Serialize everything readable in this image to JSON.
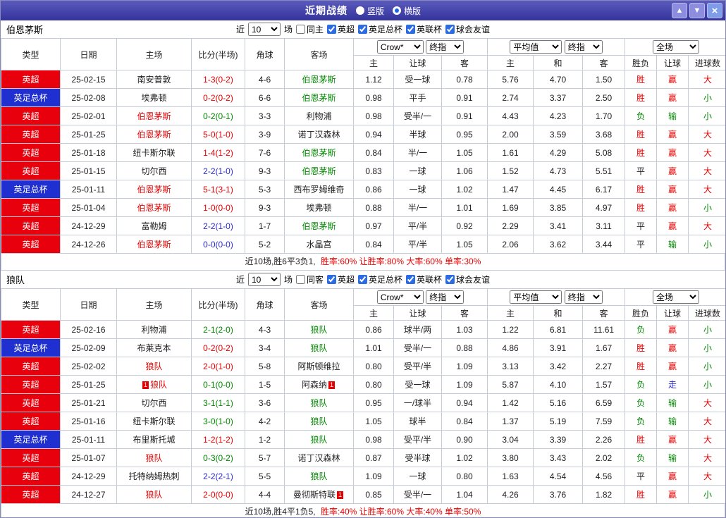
{
  "topbar": {
    "title": "近期战绩",
    "layout_options": [
      {
        "label": "竖版",
        "selected": false
      },
      {
        "label": "横版",
        "selected": true
      }
    ],
    "icons": {
      "up": "▲",
      "down": "▼",
      "close": "×"
    }
  },
  "colors": {
    "titlebar_bg": "#33339b",
    "win_red": "#e60000",
    "loss_green": "#008800",
    "draw_blue": "#2b2bd0",
    "epl_bg": "#e8000d",
    "facup_bg": "#1f2fd0"
  },
  "filters": {
    "near_label": "近",
    "count_value": "10",
    "games_label": "场",
    "leagues": [
      {
        "label": "英超",
        "checked": true
      },
      {
        "label": "英足总杯",
        "checked": true
      },
      {
        "label": "英联杯",
        "checked": true
      },
      {
        "label": "球会友谊",
        "checked": true
      }
    ]
  },
  "table_header": {
    "static_cols": [
      "类型",
      "日期",
      "主场",
      "比分(半场)",
      "角球",
      "客场"
    ],
    "group1": {
      "select_bookmaker": "Crow*",
      "select_stage": "终指"
    },
    "group2": {
      "select_avg": "平均值",
      "select_stage": "终指"
    },
    "group3": {
      "select_scope": "全场"
    },
    "sub_cols": [
      "主",
      "让球",
      "客",
      "主",
      "和",
      "客",
      "胜负",
      "让球",
      "进球数"
    ]
  },
  "sections": [
    {
      "team": "伯恩茅斯",
      "same_filter_label": "同主",
      "same_filter_checked": false,
      "summary_prefix": "近10场,胜6平3负1,",
      "summary_stats": "胜率:60% 让胜率:80% 大率:60% 单率:30%",
      "rows": [
        {
          "league": "英超",
          "league_type": "epl",
          "date": "25-02-15",
          "home": "南安普敦",
          "home_hl": false,
          "home_badge": "",
          "score": "1-3(0-2)",
          "result_type": "win",
          "corner": "4-6",
          "away": "伯恩茅斯",
          "away_hl": true,
          "away_badge": "",
          "odds": [
            "1.12",
            "受一球",
            "0.78",
            "5.76",
            "4.70",
            "1.50"
          ],
          "result": "胜",
          "result_c": "r",
          "handicap": "赢",
          "handicap_c": "r",
          "goals": "大",
          "goals_c": "r"
        },
        {
          "league": "英足总杯",
          "league_type": "facup",
          "date": "25-02-08",
          "home": "埃弗顿",
          "home_hl": false,
          "home_badge": "",
          "score": "0-2(0-2)",
          "result_type": "win",
          "corner": "6-6",
          "away": "伯恩茅斯",
          "away_hl": true,
          "away_badge": "",
          "odds": [
            "0.98",
            "平手",
            "0.91",
            "2.74",
            "3.37",
            "2.50"
          ],
          "result": "胜",
          "result_c": "r",
          "handicap": "赢",
          "handicap_c": "r",
          "goals": "小",
          "goals_c": "g"
        },
        {
          "league": "英超",
          "league_type": "epl",
          "date": "25-02-01",
          "home": "伯恩茅斯",
          "home_hl": true,
          "home_badge": "",
          "score": "0-2(0-1)",
          "result_type": "loss",
          "corner": "3-3",
          "away": "利物浦",
          "away_hl": false,
          "away_badge": "",
          "odds": [
            "0.98",
            "受半/一",
            "0.91",
            "4.43",
            "4.23",
            "1.70"
          ],
          "result": "负",
          "result_c": "g",
          "handicap": "输",
          "handicap_c": "g",
          "goals": "小",
          "goals_c": "g"
        },
        {
          "league": "英超",
          "league_type": "epl",
          "date": "25-01-25",
          "home": "伯恩茅斯",
          "home_hl": true,
          "home_badge": "",
          "score": "5-0(1-0)",
          "result_type": "win",
          "corner": "3-9",
          "away": "诺丁汉森林",
          "away_hl": false,
          "away_badge": "",
          "odds": [
            "0.94",
            "半球",
            "0.95",
            "2.00",
            "3.59",
            "3.68"
          ],
          "result": "胜",
          "result_c": "r",
          "handicap": "赢",
          "handicap_c": "r",
          "goals": "大",
          "goals_c": "r"
        },
        {
          "league": "英超",
          "league_type": "epl",
          "date": "25-01-18",
          "home": "纽卡斯尔联",
          "home_hl": false,
          "home_badge": "",
          "score": "1-4(1-2)",
          "result_type": "win",
          "corner": "7-6",
          "away": "伯恩茅斯",
          "away_hl": true,
          "away_badge": "",
          "odds": [
            "0.84",
            "半/一",
            "1.05",
            "1.61",
            "4.29",
            "5.08"
          ],
          "result": "胜",
          "result_c": "r",
          "handicap": "赢",
          "handicap_c": "r",
          "goals": "大",
          "goals_c": "r"
        },
        {
          "league": "英超",
          "league_type": "epl",
          "date": "25-01-15",
          "home": "切尔西",
          "home_hl": false,
          "home_badge": "",
          "score": "2-2(1-0)",
          "result_type": "draw",
          "corner": "9-3",
          "away": "伯恩茅斯",
          "away_hl": true,
          "away_badge": "",
          "odds": [
            "0.83",
            "一球",
            "1.06",
            "1.52",
            "4.73",
            "5.51"
          ],
          "result": "平",
          "result_c": "k",
          "handicap": "赢",
          "handicap_c": "r",
          "goals": "大",
          "goals_c": "r"
        },
        {
          "league": "英足总杯",
          "league_type": "facup",
          "date": "25-01-11",
          "home": "伯恩茅斯",
          "home_hl": true,
          "home_badge": "",
          "score": "5-1(3-1)",
          "result_type": "win",
          "corner": "5-3",
          "away": "西布罗姆维奇",
          "away_hl": false,
          "away_badge": "",
          "odds": [
            "0.86",
            "一球",
            "1.02",
            "1.47",
            "4.45",
            "6.17"
          ],
          "result": "胜",
          "result_c": "r",
          "handicap": "赢",
          "handicap_c": "r",
          "goals": "大",
          "goals_c": "r"
        },
        {
          "league": "英超",
          "league_type": "epl",
          "date": "25-01-04",
          "home": "伯恩茅斯",
          "home_hl": true,
          "home_badge": "",
          "score": "1-0(0-0)",
          "result_type": "win",
          "corner": "9-3",
          "away": "埃弗顿",
          "away_hl": false,
          "away_badge": "",
          "odds": [
            "0.88",
            "半/一",
            "1.01",
            "1.69",
            "3.85",
            "4.97"
          ],
          "result": "胜",
          "result_c": "r",
          "handicap": "赢",
          "handicap_c": "r",
          "goals": "小",
          "goals_c": "g"
        },
        {
          "league": "英超",
          "league_type": "epl",
          "date": "24-12-29",
          "home": "富勒姆",
          "home_hl": false,
          "home_badge": "",
          "score": "2-2(1-0)",
          "result_type": "draw",
          "corner": "1-7",
          "away": "伯恩茅斯",
          "away_hl": true,
          "away_badge": "",
          "odds": [
            "0.97",
            "平/半",
            "0.92",
            "2.29",
            "3.41",
            "3.11"
          ],
          "result": "平",
          "result_c": "k",
          "handicap": "赢",
          "handicap_c": "r",
          "goals": "大",
          "goals_c": "r"
        },
        {
          "league": "英超",
          "league_type": "epl",
          "date": "24-12-26",
          "home": "伯恩茅斯",
          "home_hl": true,
          "home_badge": "",
          "score": "0-0(0-0)",
          "result_type": "draw",
          "corner": "5-2",
          "away": "水晶宫",
          "away_hl": false,
          "away_badge": "",
          "odds": [
            "0.84",
            "平/半",
            "1.05",
            "2.06",
            "3.62",
            "3.44"
          ],
          "result": "平",
          "result_c": "k",
          "handicap": "输",
          "handicap_c": "g",
          "goals": "小",
          "goals_c": "g"
        }
      ]
    },
    {
      "team": "狼队",
      "same_filter_label": "同客",
      "same_filter_checked": false,
      "summary_prefix": "近10场,胜4平1负5,",
      "summary_stats": "胜率:40% 让胜率:60% 大率:40% 单率:50%",
      "rows": [
        {
          "league": "英超",
          "league_type": "epl",
          "date": "25-02-16",
          "home": "利物浦",
          "home_hl": false,
          "home_badge": "",
          "score": "2-1(2-0)",
          "result_type": "loss",
          "corner": "4-3",
          "away": "狼队",
          "away_hl": true,
          "away_badge": "",
          "odds": [
            "0.86",
            "球半/两",
            "1.03",
            "1.22",
            "6.81",
            "11.61"
          ],
          "result": "负",
          "result_c": "g",
          "handicap": "赢",
          "handicap_c": "r",
          "goals": "小",
          "goals_c": "g"
        },
        {
          "league": "英足总杯",
          "league_type": "facup",
          "date": "25-02-09",
          "home": "布莱克本",
          "home_hl": false,
          "home_badge": "",
          "score": "0-2(0-2)",
          "result_type": "win",
          "corner": "3-4",
          "away": "狼队",
          "away_hl": true,
          "away_badge": "",
          "odds": [
            "1.01",
            "受半/一",
            "0.88",
            "4.86",
            "3.91",
            "1.67"
          ],
          "result": "胜",
          "result_c": "r",
          "handicap": "赢",
          "handicap_c": "r",
          "goals": "小",
          "goals_c": "g"
        },
        {
          "league": "英超",
          "league_type": "epl",
          "date": "25-02-02",
          "home": "狼队",
          "home_hl": true,
          "home_badge": "",
          "score": "2-0(1-0)",
          "result_type": "win",
          "corner": "5-8",
          "away": "阿斯顿维拉",
          "away_hl": false,
          "away_badge": "",
          "odds": [
            "0.80",
            "受平/半",
            "1.09",
            "3.13",
            "3.42",
            "2.27"
          ],
          "result": "胜",
          "result_c": "r",
          "handicap": "赢",
          "handicap_c": "r",
          "goals": "小",
          "goals_c": "g"
        },
        {
          "league": "英超",
          "league_type": "epl",
          "date": "25-01-25",
          "home": "狼队",
          "home_hl": true,
          "home_badge": "1",
          "score": "0-1(0-0)",
          "result_type": "loss",
          "corner": "1-5",
          "away": "阿森纳",
          "away_hl": false,
          "away_badge": "1",
          "odds": [
            "0.80",
            "受一球",
            "1.09",
            "5.87",
            "4.10",
            "1.57"
          ],
          "result": "负",
          "result_c": "g",
          "handicap": "走",
          "handicap_c": "b",
          "goals": "小",
          "goals_c": "g"
        },
        {
          "league": "英超",
          "league_type": "epl",
          "date": "25-01-21",
          "home": "切尔西",
          "home_hl": false,
          "home_badge": "",
          "score": "3-1(1-1)",
          "result_type": "loss",
          "corner": "3-6",
          "away": "狼队",
          "away_hl": true,
          "away_badge": "",
          "odds": [
            "0.95",
            "一/球半",
            "0.94",
            "1.42",
            "5.16",
            "6.59"
          ],
          "result": "负",
          "result_c": "g",
          "handicap": "输",
          "handicap_c": "g",
          "goals": "大",
          "goals_c": "r"
        },
        {
          "league": "英超",
          "league_type": "epl",
          "date": "25-01-16",
          "home": "纽卡斯尔联",
          "home_hl": false,
          "home_badge": "",
          "score": "3-0(1-0)",
          "result_type": "loss",
          "corner": "4-2",
          "away": "狼队",
          "away_hl": true,
          "away_badge": "",
          "odds": [
            "1.05",
            "球半",
            "0.84",
            "1.37",
            "5.19",
            "7.59"
          ],
          "result": "负",
          "result_c": "g",
          "handicap": "输",
          "handicap_c": "g",
          "goals": "大",
          "goals_c": "r"
        },
        {
          "league": "英足总杯",
          "league_type": "facup",
          "date": "25-01-11",
          "home": "布里斯托城",
          "home_hl": false,
          "home_badge": "",
          "score": "1-2(1-2)",
          "result_type": "win",
          "corner": "1-2",
          "away": "狼队",
          "away_hl": true,
          "away_badge": "",
          "odds": [
            "0.98",
            "受平/半",
            "0.90",
            "3.04",
            "3.39",
            "2.26"
          ],
          "result": "胜",
          "result_c": "r",
          "handicap": "赢",
          "handicap_c": "r",
          "goals": "大",
          "goals_c": "r"
        },
        {
          "league": "英超",
          "league_type": "epl",
          "date": "25-01-07",
          "home": "狼队",
          "home_hl": true,
          "home_badge": "",
          "score": "0-3(0-2)",
          "result_type": "loss",
          "corner": "5-7",
          "away": "诺丁汉森林",
          "away_hl": false,
          "away_badge": "",
          "odds": [
            "0.87",
            "受半球",
            "1.02",
            "3.80",
            "3.43",
            "2.02"
          ],
          "result": "负",
          "result_c": "g",
          "handicap": "输",
          "handicap_c": "g",
          "goals": "大",
          "goals_c": "r"
        },
        {
          "league": "英超",
          "league_type": "epl",
          "date": "24-12-29",
          "home": "托特纳姆热刺",
          "home_hl": false,
          "home_badge": "",
          "score": "2-2(2-1)",
          "result_type": "draw",
          "corner": "5-5",
          "away": "狼队",
          "away_hl": true,
          "away_badge": "",
          "odds": [
            "1.09",
            "一球",
            "0.80",
            "1.63",
            "4.54",
            "4.56"
          ],
          "result": "平",
          "result_c": "k",
          "handicap": "赢",
          "handicap_c": "r",
          "goals": "大",
          "goals_c": "r"
        },
        {
          "league": "英超",
          "league_type": "epl",
          "date": "24-12-27",
          "home": "狼队",
          "home_hl": true,
          "home_badge": "",
          "score": "2-0(0-0)",
          "result_type": "win",
          "corner": "4-4",
          "away": "曼彻斯特联",
          "away_hl": false,
          "away_badge": "1",
          "odds": [
            "0.85",
            "受半/一",
            "1.04",
            "4.26",
            "3.76",
            "1.82"
          ],
          "result": "胜",
          "result_c": "r",
          "handicap": "赢",
          "handicap_c": "r",
          "goals": "小",
          "goals_c": "g"
        }
      ]
    }
  ]
}
